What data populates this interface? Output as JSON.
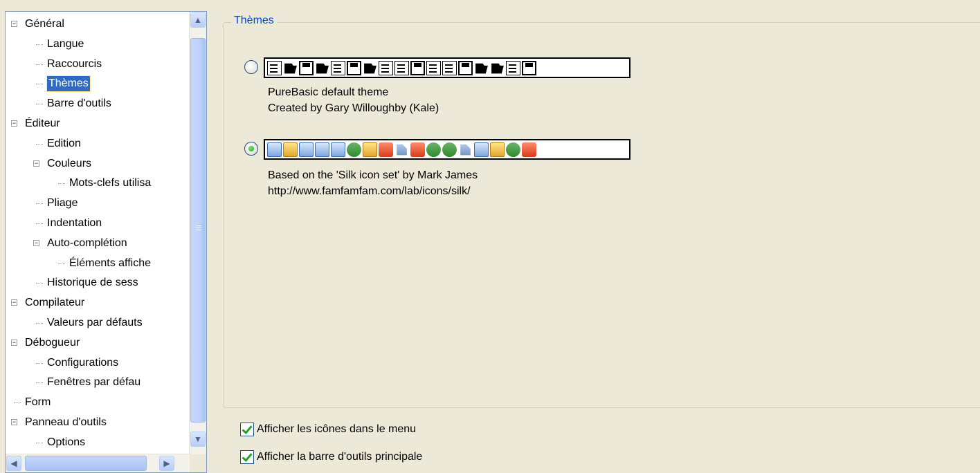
{
  "tree": {
    "items": [
      {
        "label": "Général",
        "level": 0,
        "expander": "⊟"
      },
      {
        "label": "Langue",
        "level": 1
      },
      {
        "label": "Raccourcis",
        "level": 1
      },
      {
        "label": "Thèmes",
        "level": 1,
        "selected": true
      },
      {
        "label": "Barre d'outils",
        "level": 1
      },
      {
        "label": "Éditeur",
        "level": 0,
        "expander": "⊟"
      },
      {
        "label": "Edition",
        "level": 1
      },
      {
        "label": "Couleurs",
        "level": 1,
        "expander": "⊟"
      },
      {
        "label": "Mots-clefs utilisa",
        "level": 2
      },
      {
        "label": "Pliage",
        "level": 1
      },
      {
        "label": "Indentation",
        "level": 1
      },
      {
        "label": "Auto-complétion",
        "level": 1,
        "expander": "⊟"
      },
      {
        "label": "Éléments affiche",
        "level": 2
      },
      {
        "label": "Historique de sess",
        "level": 1
      },
      {
        "label": "Compilateur",
        "level": 0,
        "expander": "⊟"
      },
      {
        "label": "Valeurs par défauts",
        "level": 1
      },
      {
        "label": "Débogueur",
        "level": 0,
        "expander": "⊟"
      },
      {
        "label": "Configurations",
        "level": 1
      },
      {
        "label": "Fenêtres par défau",
        "level": 1
      },
      {
        "label": "Form",
        "level": 0
      },
      {
        "label": "Panneau d'outils",
        "level": 0,
        "expander": "⊟"
      },
      {
        "label": "Options",
        "level": 1
      }
    ],
    "scroll_up": "▲",
    "scroll_down": "▼",
    "scroll_left": "◀",
    "scroll_right": "▶"
  },
  "group": {
    "title": "Thèmes"
  },
  "themes": [
    {
      "name": "purebasic-default",
      "selected": false,
      "line1": "PureBasic default theme",
      "line2": "Created by Gary Willoughby (Kale)"
    },
    {
      "name": "silk",
      "selected": true,
      "line1": "Based on the 'Silk icon set' by Mark James",
      "line2": "http://www.famfamfam.com/lab/icons/silk/"
    }
  ],
  "options": {
    "menu_icons_label": "Afficher les icônes dans le menu",
    "menu_icons_checked": true,
    "toolbar_label": "Afficher la barre d'outils principale",
    "toolbar_checked": true
  },
  "colors": {
    "selection": "#316ac5",
    "group_title": "#0046d5",
    "background": "#ece9d8"
  }
}
